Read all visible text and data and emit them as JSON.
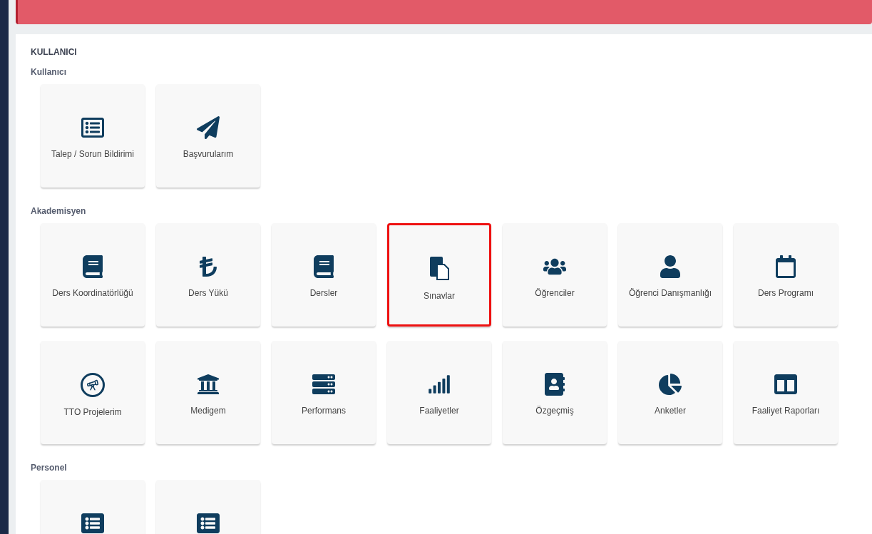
{
  "section_title": "KULLANICI",
  "groups": [
    {
      "title": "Kullanıcı",
      "tiles": [
        {
          "kind": "form",
          "label": "Talep / Sorun Bildirimi",
          "highlighted": false
        },
        {
          "kind": "plane",
          "label": "Başvurularım",
          "highlighted": false
        }
      ]
    },
    {
      "title": "Akademisyen",
      "tiles": [
        {
          "kind": "book",
          "label": "Ders Koordinatörlüğü",
          "highlighted": false
        },
        {
          "kind": "lira",
          "label": "Ders Yükü",
          "highlighted": false
        },
        {
          "kind": "book",
          "label": "Dersler",
          "highlighted": false
        },
        {
          "kind": "copy",
          "label": "Sınavlar",
          "highlighted": true
        },
        {
          "kind": "users",
          "label": "Öğrenciler",
          "highlighted": false
        },
        {
          "kind": "user",
          "label": "Öğrenci Danışmanlığı",
          "highlighted": false
        },
        {
          "kind": "calendar",
          "label": "Ders Programı",
          "highlighted": false
        },
        {
          "kind": "telescope",
          "label": "TTO Projelerim",
          "highlighted": false
        },
        {
          "kind": "bank",
          "label": "Medigem",
          "highlighted": false
        },
        {
          "kind": "server",
          "label": "Performans",
          "highlighted": false
        },
        {
          "kind": "signal",
          "label": "Faaliyetler",
          "highlighted": false
        },
        {
          "kind": "contact",
          "label": "Özgeçmiş",
          "highlighted": false
        },
        {
          "kind": "pie",
          "label": "Anketler",
          "highlighted": false
        },
        {
          "kind": "columns",
          "label": "Faaliyet Raporları",
          "highlighted": false
        }
      ]
    },
    {
      "title": "Personel",
      "tiles": [
        {
          "kind": "list",
          "highlighted": false
        },
        {
          "kind": "list",
          "highlighted": false
        }
      ]
    }
  ]
}
